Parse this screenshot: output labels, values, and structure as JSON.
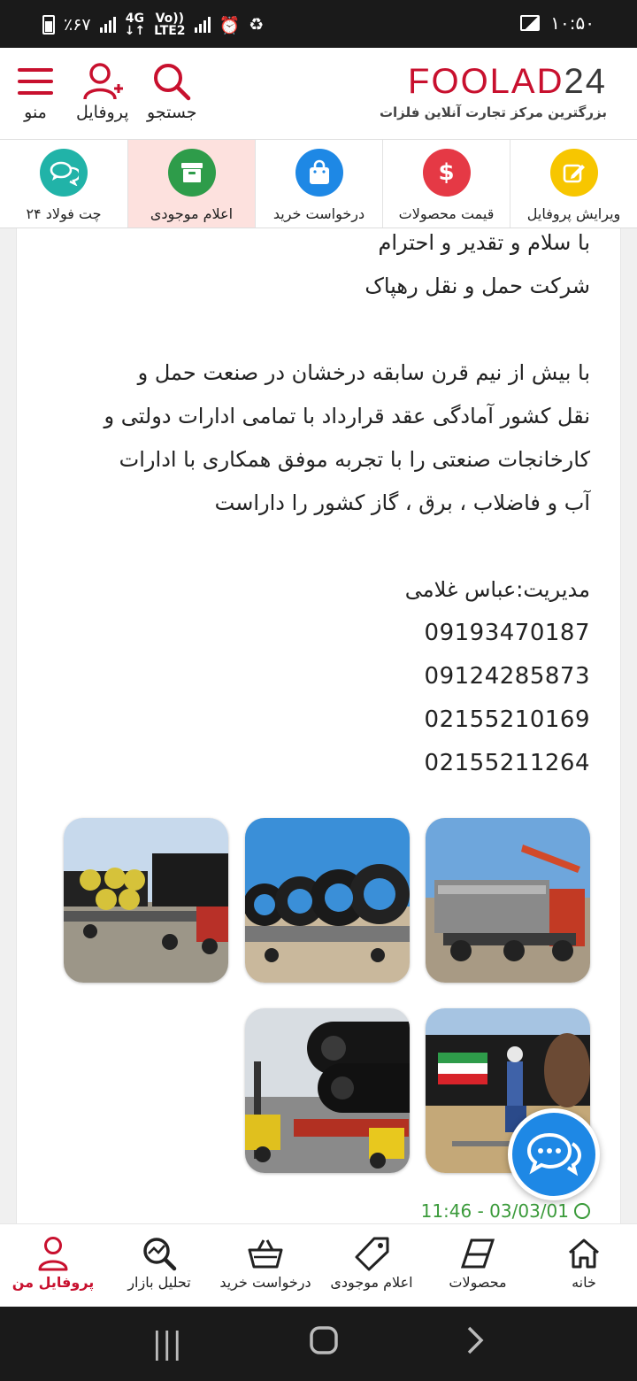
{
  "status_bar": {
    "battery": "٪۶۷",
    "network_top": "4G",
    "network_bottom": "LTE2",
    "volte_top": "Vo))",
    "time": "۱۰:۵۰"
  },
  "header": {
    "brand_text": "FOOLAD",
    "brand_number": "24",
    "tagline": "بزرگترین مرکز تجارت آنلاین فلزات",
    "search_label": "جستجو",
    "profile_label": "پروفایل",
    "menu_label": "منو"
  },
  "quick_menu": [
    {
      "label": "ویرایش پروفایل",
      "icon": "edit-icon",
      "color": "#f7c600"
    },
    {
      "label": "قیمت محصولات",
      "icon": "dollar-icon",
      "color": "#e53945"
    },
    {
      "label": "درخواست خرید",
      "icon": "shopping-bag-icon",
      "color": "#1e88e5"
    },
    {
      "label": "اعلام موجودی",
      "icon": "archive-icon",
      "color": "#2e9c4a"
    },
    {
      "label": "چت فولاد ۲۴",
      "icon": "chat-icon",
      "color": "#21b3a8"
    }
  ],
  "content": {
    "lines": [
      "با سلام و تقدیر و احترام",
      "شرکت حمل و نقل رهپاک",
      "",
      "با بیش از نیم قرن سابقه درخشان در صنعت حمل و",
      "نقل کشور آمادگی عقد قرارداد با تمامی ادارات دولتی و",
      "کارخانجات صنعتی را با تجربه موفق همکاری با ادارات",
      "آب و فاضلاب ، برق ، گاز کشور را داراست",
      "",
      "مدیریت:عباس غلامی"
    ],
    "phones": [
      "09193470187",
      "09124285873",
      "02155210169",
      "02155211264"
    ],
    "timestamp": "11:46 - 03/03/01"
  },
  "bottom_nav": [
    {
      "label": "خانه",
      "icon": "home-icon"
    },
    {
      "label": "محصولات",
      "icon": "products-icon"
    },
    {
      "label": "اعلام موجودی",
      "icon": "tag-icon"
    },
    {
      "label": "درخواست خرید",
      "icon": "basket-icon"
    },
    {
      "label": "تحلیل بازار",
      "icon": "analysis-icon"
    },
    {
      "label": "پروفایل من",
      "icon": "user-icon",
      "active": true
    }
  ],
  "colors": {
    "brand_red": "#c8102e",
    "timestamp_green": "#3a9a3a",
    "chat_blue": "#1e88e5"
  }
}
